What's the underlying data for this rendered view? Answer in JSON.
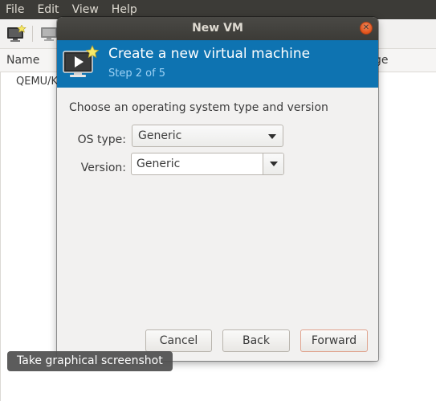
{
  "menubar": {
    "items": [
      "File",
      "Edit",
      "View",
      "Help"
    ]
  },
  "toolbar": {
    "new_vm_icon": "new-vm-icon",
    "open_console_icon": "monitor-icon"
  },
  "list": {
    "columns": {
      "name": "Name",
      "usage": "ge"
    },
    "connection": "QEMU/KV"
  },
  "dialog": {
    "title": "New VM",
    "close_icon": "close-icon",
    "banner": {
      "title": "Create a new virtual machine",
      "step": "Step 2 of 5",
      "icon": "new-vm-icon",
      "color": "#0e73b1"
    },
    "prompt": "Choose an operating system type and version",
    "os_type": {
      "label": "OS type:",
      "value": "Generic"
    },
    "version": {
      "label": "Version:",
      "value": "Generic"
    },
    "buttons": {
      "cancel": "Cancel",
      "back": "Back",
      "forward": "Forward"
    }
  },
  "tooltip": {
    "text": "Take graphical screenshot"
  }
}
